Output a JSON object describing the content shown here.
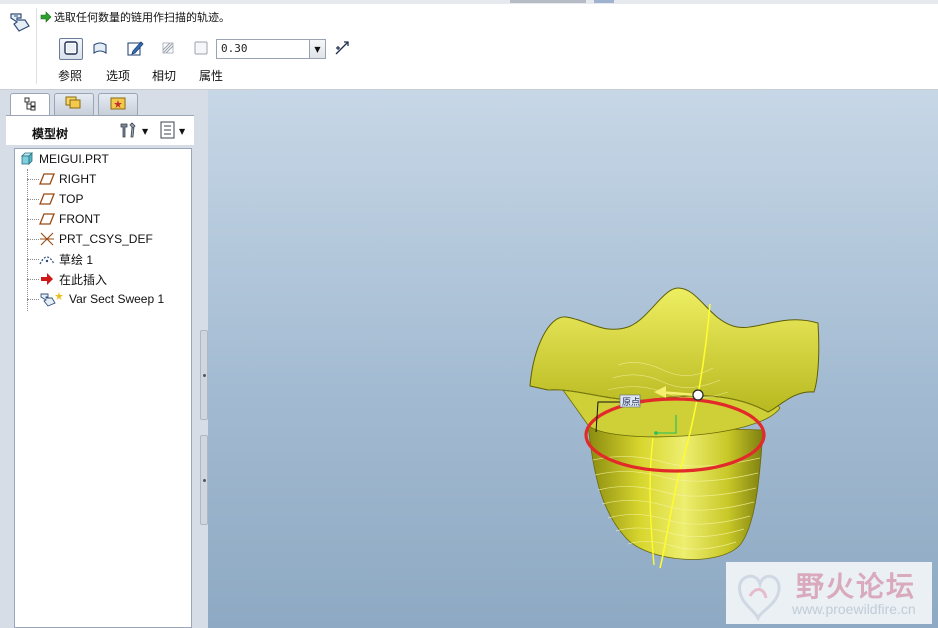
{
  "dashboard": {
    "message": "选取任何数量的链用作扫描的轨迹。",
    "value": "0.30",
    "tabs": [
      "参照",
      "选项",
      "相切",
      "属性"
    ],
    "icons": [
      "sweep-feature-icon",
      "solid-icon",
      "surface-icon",
      "sketch-icon",
      "thicken-icon",
      "remove-material-icon",
      "flip-icon"
    ]
  },
  "model_tree": {
    "title": "模型树",
    "nav_tabs": [
      "model-tree-tab",
      "folder-browser-tab",
      "favorites-tab"
    ],
    "items": [
      {
        "label": "MEIGUI.PRT",
        "icon": "part-icon"
      },
      {
        "label": "RIGHT",
        "icon": "datum-plane-icon"
      },
      {
        "label": "TOP",
        "icon": "datum-plane-icon"
      },
      {
        "label": "FRONT",
        "icon": "datum-plane-icon"
      },
      {
        "label": "PRT_CSYS_DEF",
        "icon": "csys-icon"
      },
      {
        "label": "草绘 1",
        "icon": "sketch-curve-icon"
      },
      {
        "label": "在此插入",
        "icon": "insert-here-arrow-icon"
      },
      {
        "label": "Var Sect Sweep 1",
        "icon": "var-sect-sweep-icon"
      }
    ]
  },
  "viewport": {
    "label": "原点",
    "colors": {
      "surface": "#d8d830",
      "trajectory": "#e03030",
      "background": "#a3bbd2"
    }
  },
  "watermark": {
    "title": "野火论坛",
    "url": "www.proewildfire.cn"
  }
}
